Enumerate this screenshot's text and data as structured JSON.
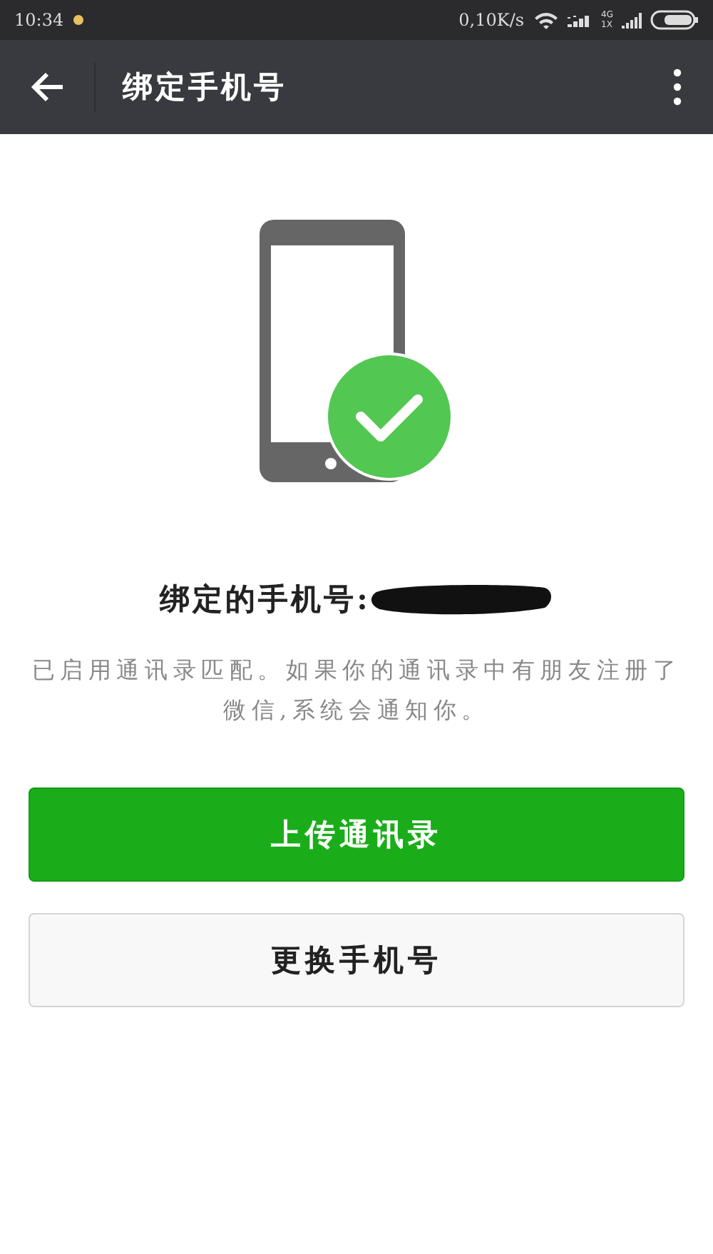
{
  "status_bar": {
    "time": "10:34",
    "speed": "0,10K/s",
    "network_type": "4G",
    "network_subtype": "1X"
  },
  "app_bar": {
    "title": "绑定手机号"
  },
  "content": {
    "heading": "绑定的手机号:",
    "number_redacted": true,
    "description": "已启用通讯录匹配。如果你的通讯录中有朋友注册了微信,系统会通知你。"
  },
  "buttons": [
    {
      "label": "上传通讯录",
      "kind": "primary"
    },
    {
      "label": "更换手机号",
      "kind": "secondary"
    }
  ]
}
